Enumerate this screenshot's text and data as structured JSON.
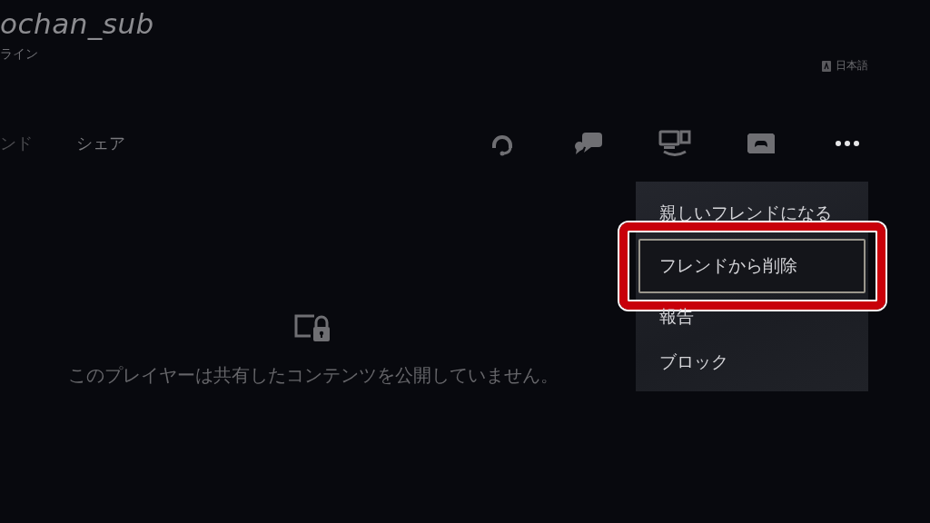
{
  "profile": {
    "name": "ochan_sub",
    "status": "ライン"
  },
  "language": {
    "label": "日本語"
  },
  "tabs": [
    {
      "label": "ンド"
    },
    {
      "label": "シェア"
    }
  ],
  "actions": [
    {
      "kind": "voice-chat"
    },
    {
      "kind": "message"
    },
    {
      "kind": "share-screen"
    },
    {
      "kind": "game"
    },
    {
      "kind": "more"
    }
  ],
  "menu": {
    "items": [
      {
        "label": "親しいフレンドになる",
        "selected": false
      },
      {
        "label": "フレンドから削除",
        "selected": true
      },
      {
        "label": "報告",
        "selected": false
      },
      {
        "label": "ブロック",
        "selected": false
      }
    ]
  },
  "empty_state": {
    "message": "このプレイヤーは共有したコンテンツを公開していません。"
  }
}
